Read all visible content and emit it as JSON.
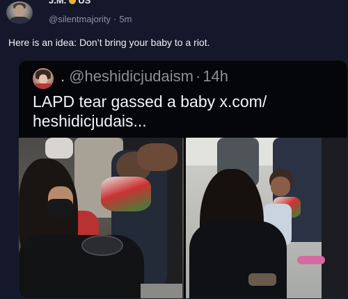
{
  "post": {
    "display_name": "J.M.",
    "country": "US",
    "handle": "@silentmajority",
    "separator": "·",
    "time": "5m",
    "text": "Here is an idea: Don’t bring your baby to a riot."
  },
  "quoted_post": {
    "lead_dot": ".",
    "handle": "@heshidicjudaism",
    "separator": "·",
    "time": "14h",
    "text": "LAPD tear gassed a baby x.com/ heshidicjudais..."
  },
  "colors": {
    "background": "#15182a",
    "quote_background": "#05060a",
    "muted_text": "#8d93ab",
    "badge": "#e6b43a"
  },
  "icons": {
    "verified": "gold-circle-badge"
  }
}
